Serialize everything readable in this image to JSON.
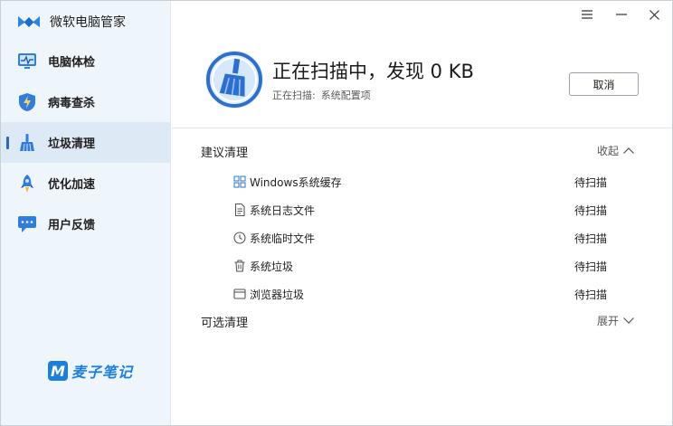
{
  "app": {
    "name": "微软电脑管家",
    "accent": "#2a67c4"
  },
  "sidebar": {
    "items": [
      {
        "label": "电脑体检",
        "icon": "monitor-icon"
      },
      {
        "label": "病毒查杀",
        "icon": "shield-lightning-icon"
      },
      {
        "label": "垃圾清理",
        "icon": "broom-icon",
        "active": true
      },
      {
        "label": "优化加速",
        "icon": "rocket-icon"
      },
      {
        "label": "用户反馈",
        "icon": "chat-icon"
      }
    ]
  },
  "watermark": {
    "mark": "M",
    "text": "麦子笔记"
  },
  "scan": {
    "title": "正在扫描中，发现 0 KB",
    "status_label": "正在扫描:",
    "status_value": "系统配置项",
    "cancel_label": "取消"
  },
  "sections": {
    "recommended": {
      "title": "建议清理",
      "toggle": "收起",
      "items": [
        {
          "label": "Windows系统缓存",
          "status": "待扫描",
          "icon": "windows-icon"
        },
        {
          "label": "系统日志文件",
          "status": "待扫描",
          "icon": "document-icon"
        },
        {
          "label": "系统临时文件",
          "status": "待扫描",
          "icon": "clock-icon"
        },
        {
          "label": "系统垃圾",
          "status": "待扫描",
          "icon": "trash-icon"
        },
        {
          "label": "浏览器垃圾",
          "status": "待扫描",
          "icon": "browser-icon"
        }
      ]
    },
    "optional": {
      "title": "可选清理",
      "toggle": "展开"
    }
  }
}
